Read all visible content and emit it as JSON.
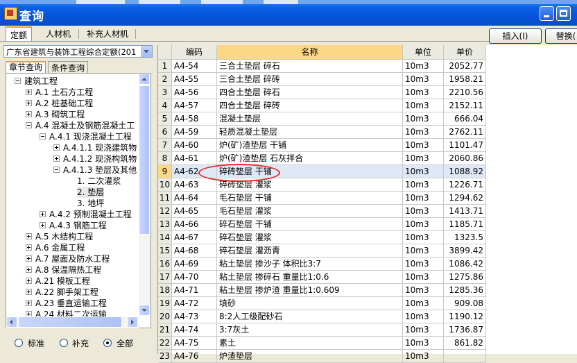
{
  "window": {
    "title": "查询"
  },
  "top_tabs": [
    "定额",
    "人材机",
    "补充人材机"
  ],
  "buttons": {
    "insert": "插入(I)",
    "replace": "替换("
  },
  "quota_library": "广东省建筑与装饰工程综合定额(201",
  "sub_tabs": [
    "章节查询",
    "条件查询"
  ],
  "tree": [
    {
      "label": "建筑工程",
      "state": "expanded",
      "level": 0
    },
    {
      "label": "A.1 土石方工程",
      "state": "collapsed",
      "level": 1
    },
    {
      "label": "A.2 桩基础工程",
      "state": "collapsed",
      "level": 1
    },
    {
      "label": "A.3 砌筑工程",
      "state": "collapsed",
      "level": 1
    },
    {
      "label": "A.4 混凝土及钢筋混凝土工",
      "state": "expanded",
      "level": 1
    },
    {
      "label": "A.4.1 现浇混凝土工程",
      "state": "expanded",
      "level": 2
    },
    {
      "label": "A.4.1.1 现浇建筑物",
      "state": "collapsed",
      "level": 3
    },
    {
      "label": "A.4.1.2 现浇构筑物",
      "state": "collapsed",
      "level": 3
    },
    {
      "label": "A.4.1.3 垫层及其他",
      "state": "expanded",
      "level": 3
    },
    {
      "label": "1. 二次灌浆",
      "state": "leaf",
      "level": 4
    },
    {
      "label": "2. 垫层",
      "state": "leaf",
      "level": 4,
      "selected": true
    },
    {
      "label": "3. 地坪",
      "state": "leaf",
      "level": 4
    },
    {
      "label": "A.4.2 预制混凝土工程",
      "state": "collapsed",
      "level": 2
    },
    {
      "label": "A.4.3 钢筋工程",
      "state": "collapsed",
      "level": 2
    },
    {
      "label": "A.5 木结构工程",
      "state": "collapsed",
      "level": 1
    },
    {
      "label": "A.6 金属工程",
      "state": "collapsed",
      "level": 1
    },
    {
      "label": "A.7 屋面及防水工程",
      "state": "collapsed",
      "level": 1
    },
    {
      "label": "A.8 保温隔热工程",
      "state": "collapsed",
      "level": 1
    },
    {
      "label": "A.21 模板工程",
      "state": "collapsed",
      "level": 1
    },
    {
      "label": "A.22 脚手架工程",
      "state": "collapsed",
      "level": 1
    },
    {
      "label": "A.23 垂直运输工程",
      "state": "collapsed",
      "level": 1
    },
    {
      "label": "A.24 材料二次运输",
      "state": "collapsed",
      "level": 1
    }
  ],
  "filter_options": [
    "标准",
    "补充",
    "全部"
  ],
  "filter_selected": 2,
  "table": {
    "columns": [
      "编码",
      "名称",
      "单位",
      "单价"
    ],
    "selected_row": 9,
    "rows": [
      [
        "1",
        "A4-54",
        "三合土垫层 碎石",
        "10m3",
        "2052.77"
      ],
      [
        "2",
        "A4-55",
        "三合土垫层 碎砖",
        "10m3",
        "1958.21"
      ],
      [
        "3",
        "A4-56",
        "四合土垫层 碎石",
        "10m3",
        "2210.56"
      ],
      [
        "4",
        "A4-57",
        "四合土垫层 碎砖",
        "10m3",
        "2152.11"
      ],
      [
        "5",
        "A4-58",
        "混凝土垫层",
        "10m3",
        "666.04"
      ],
      [
        "6",
        "A4-59",
        "轻质混凝土垫层",
        "10m3",
        "2762.11"
      ],
      [
        "7",
        "A4-60",
        "炉(矿)渣垫层 干铺",
        "10m3",
        "1101.47"
      ],
      [
        "8",
        "A4-61",
        "炉(矿)渣垫层 石灰拌合",
        "10m3",
        "2060.86"
      ],
      [
        "9",
        "A4-62",
        "碎砖垫层 干铺",
        "10m3",
        "1088.92"
      ],
      [
        "10",
        "A4-63",
        "碎砖垫层 灌浆",
        "10m3",
        "1226.71"
      ],
      [
        "11",
        "A4-64",
        "毛石垫层 干铺",
        "10m3",
        "1294.62"
      ],
      [
        "12",
        "A4-65",
        "毛石垫层 灌浆",
        "10m3",
        "1413.71"
      ],
      [
        "13",
        "A4-66",
        "碎石垫层 干铺",
        "10m3",
        "1185.71"
      ],
      [
        "14",
        "A4-67",
        "碎石垫层 灌浆",
        "10m3",
        "1323.5"
      ],
      [
        "15",
        "A4-68",
        "碎石垫层 灌沥青",
        "10m3",
        "3899.42"
      ],
      [
        "16",
        "A4-69",
        "粘土垫层 掺沙子 体积比3:7",
        "10m3",
        "1086.42"
      ],
      [
        "17",
        "A4-70",
        "粘土垫层 掺碎石 重量比1:0.6",
        "10m3",
        "1275.86"
      ],
      [
        "18",
        "A4-71",
        "粘土垫层 掺炉渣 重量比1:0.609",
        "10m3",
        "1285.36"
      ],
      [
        "19",
        "A4-72",
        "填砂",
        "10m3",
        "909.08"
      ],
      [
        "20",
        "A4-73",
        "8:2人工级配砂石",
        "10m3",
        "1190.12"
      ],
      [
        "21",
        "A4-74",
        "3:7灰土",
        "10m3",
        "1736.87"
      ],
      [
        "22",
        "A4-75",
        "素土",
        "10m3",
        "861.82"
      ],
      [
        "23",
        "A4-76",
        "炉渣垫层",
        "10m3",
        ""
      ]
    ]
  }
}
